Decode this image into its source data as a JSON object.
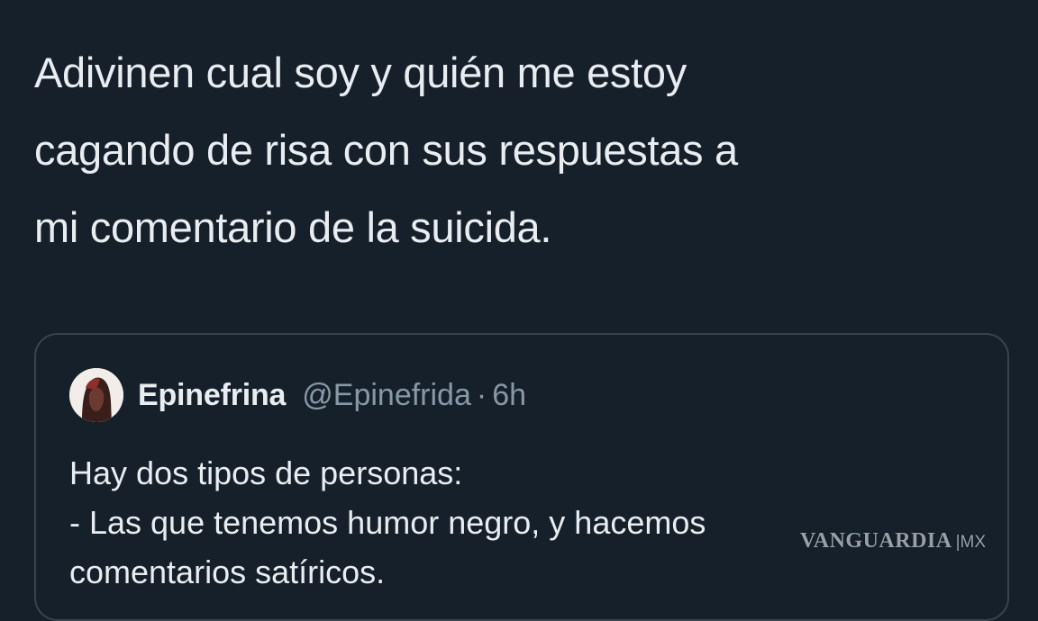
{
  "tweet": {
    "text_lines": [
      "Adivinen cual soy y quién me estoy",
      "cagando de risa con sus respuestas a",
      "mi comentario de la suicida."
    ]
  },
  "quoted_tweet": {
    "author_name": "Epinefrina",
    "author_handle": "@Epinefrida",
    "separator": "·",
    "time": "6h",
    "avatar_icon": "profile-avatar",
    "text_lines": [
      "Hay dos tipos de personas:",
      "- Las que tenemos humor negro, y hacemos",
      "comentarios satíricos."
    ]
  },
  "watermark": {
    "brand": "VANGUARDIA",
    "suffix": "|MX"
  },
  "colors": {
    "background": "#15202b",
    "text": "#e9edf0",
    "secondary_text": "#8899a6",
    "card_border": "#38444d"
  }
}
